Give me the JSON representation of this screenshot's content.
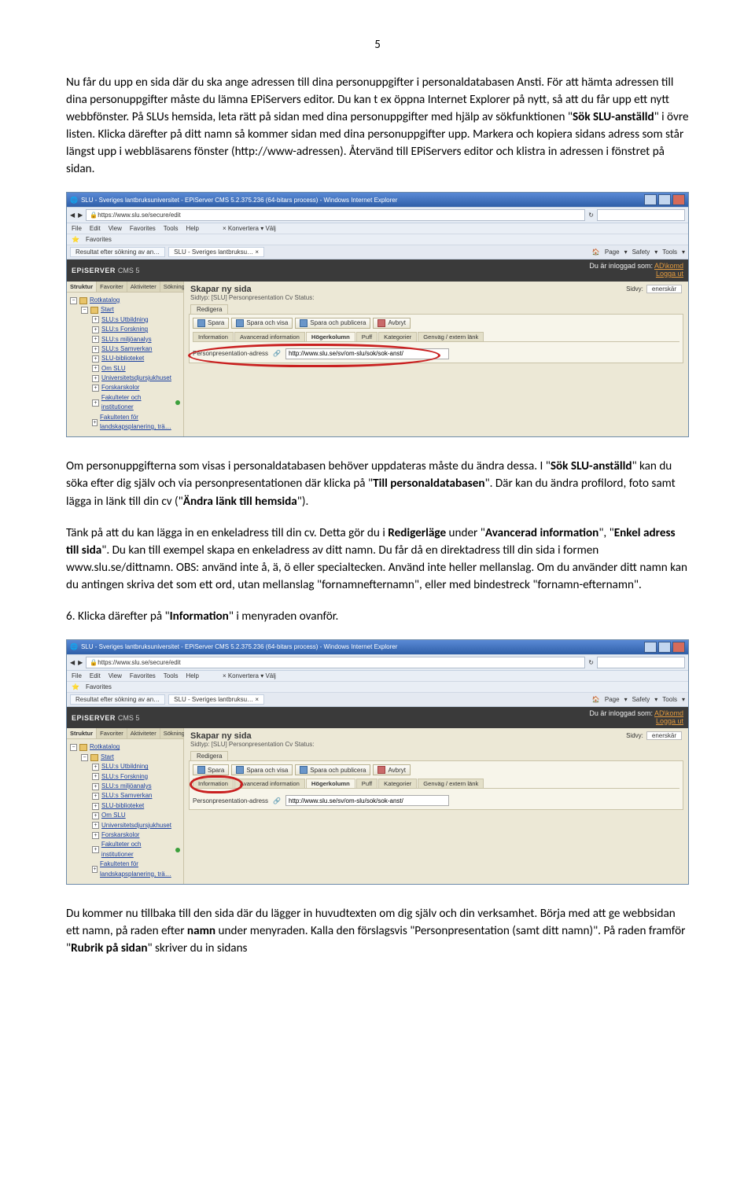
{
  "page_number": "5",
  "para1": "Nu får du upp en sida där du ska ange adressen till dina personuppgifter i personaldatabasen Ansti. För att hämta adressen till dina personuppgifter måste du lämna EPiServers editor. Du kan t ex öppna Internet Explorer på nytt, så att du får upp ett nytt webbfönster. På SLUs hemsida, leta rätt på sidan med dina personuppgifter med hjälp av sökfunktionen \"",
  "para1_bold": "Sök SLU-anställd",
  "para1_after": "\" i övre listen. Klicka därefter på ditt namn så kommer sidan med dina personuppgifter upp. Markera och kopiera sidans adress som står längst upp i webbläsarens fönster (http://www-adressen). Återvänd till EPiServers editor och klistra in adressen i fönstret på sidan.",
  "para2_a": "Om personuppgifterna som visas i personaldatabasen behöver uppdateras måste du ändra dessa. I \"",
  "para2_b": "Sök SLU-anställd",
  "para2_c": "\" kan du söka efter dig själv och via personpresentationen där klicka på \"",
  "para2_d": "Till personaldatabasen",
  "para2_e": "\". Där kan du ändra profilord, foto samt lägga in länk till din cv (\"",
  "para2_f": "Ändra länk till hemsida",
  "para2_g": "\").",
  "para3_a": "Tänk på att du kan lägga in en enkeladress till din cv. Detta gör du i ",
  "para3_b": "Redigerläge",
  "para3_c": " under \"",
  "para3_d": "Avancerad information",
  "para3_e": "\", \"",
  "para3_f": "Enkel adress till sida",
  "para3_g": "\". Du kan till exempel skapa en enkeladress av ditt namn. Du får då en direktadress till din sida i formen www.slu.se/dittnamn. OBS: använd inte å, ä, ö eller specialtecken. Använd inte heller mellanslag. Om du använder ditt namn kan du antingen skriva det som ett ord, utan mellanslag \"fornamnefternamn\", eller med bindestreck \"fornamn-efternamn\".",
  "para4_a": "6. Klicka därefter på \"",
  "para4_b": "Information",
  "para4_c": "\" i menyraden ovanför.",
  "para5_a": "Du kommer nu tillbaka till den sida där du lägger in huvudtexten om dig själv och din verksamhet. Börja med att ge webbsidan ett namn, på raden efter ",
  "para5_b": "namn",
  "para5_c": " under menyraden. Kalla den förslagsvis \"Personpresentation (samt ditt namn)\". På raden framför \"",
  "para5_d": "Rubrik på sidan",
  "para5_e": "\" skriver du in sidans",
  "ie": {
    "title": "SLU - Sveriges lantbruksuniversitet - EPiServer CMS 5.2.375.236 (64-bitars process) - Windows Internet Explorer",
    "url": "https://www.slu.se/secure/edit",
    "menu": [
      "File",
      "Edit",
      "View",
      "Favorites",
      "Tools",
      "Help"
    ],
    "konv": "Konvertera",
    "valj": "Välj",
    "fav": "Favorites",
    "tab1": "Resultat efter sökning av an…",
    "tab2": "SLU - Sveriges lantbruksu… ×",
    "rtools": [
      "Page",
      "Safety",
      "Tools"
    ]
  },
  "epi": {
    "logo": "EPiSERVER",
    "ver": "CMS 5",
    "login_pre": "Du är inloggad som:",
    "login_name": "AD\\komd",
    "logout": "Logga ut",
    "side_tabs": [
      "Struktur",
      "Favoriter",
      "Aktiviteter",
      "Sökning"
    ],
    "tree_root": "Rotkatalog",
    "tree_start": "Start",
    "tree_items": [
      "SLU:s Utbildning",
      "SLU:s Forskning",
      "SLU:s miljöanalys",
      "SLU:s Samverkan",
      "SLU-biblioteket",
      "Om SLU",
      "Universitetsdjursjukhuset",
      "Forskarskolor",
      "Fakulteter och institutioner",
      "Fakulteten för landskapsplanering, trä…"
    ],
    "page_title": "Skapar ny sida",
    "sidtyp": "Sidtyp: [SLU] Personpresentation Cv    Status:",
    "sidvy": "Sidvy:",
    "sidvy_sel": "enerskär",
    "redigera": "Redigera",
    "btns": [
      "Spara",
      "Spara och visa",
      "Spara och publicera",
      "Avbryt"
    ],
    "body_tabs": [
      "Information",
      "Avancerad information",
      "Högerkolumn",
      "Puff",
      "Kategorier",
      "Genväg / extern länk"
    ],
    "field_label": "Personpresentation-adress",
    "field_value": "http://www.slu.se/sv/om-slu/sok/sok-anst/"
  }
}
